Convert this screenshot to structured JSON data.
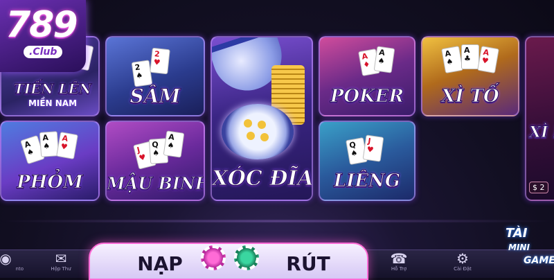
{
  "brand": {
    "logo_number": "789",
    "logo_suffix": ".Club"
  },
  "games": [
    {
      "title": "TIẾN LÊN",
      "subtitle": "MIỀN NAM"
    },
    {
      "title": "SÂM"
    },
    {
      "title": "XÓC ĐĨA"
    },
    {
      "title": "POKER"
    },
    {
      "title": "XÌ TỐ"
    },
    {
      "title": "PHỎM"
    },
    {
      "title": "MẬU BINH"
    },
    {
      "title": "LIÊNG"
    },
    {
      "title": "XÌ L",
      "currency": "$ 2"
    }
  ],
  "bottom_nav": {
    "left_partial": "nto",
    "inbox": "Hộp Thư",
    "support": "Hỗ Trợ",
    "settings": "Cài Đặt"
  },
  "actions": {
    "deposit": "NẠP",
    "withdraw": "RÚT"
  },
  "promo": {
    "line1": "TÀI",
    "line2": "MINI",
    "line3": "GAME"
  },
  "colors": {
    "accent": "#ff5ad6",
    "frame": "#9b6bff"
  }
}
